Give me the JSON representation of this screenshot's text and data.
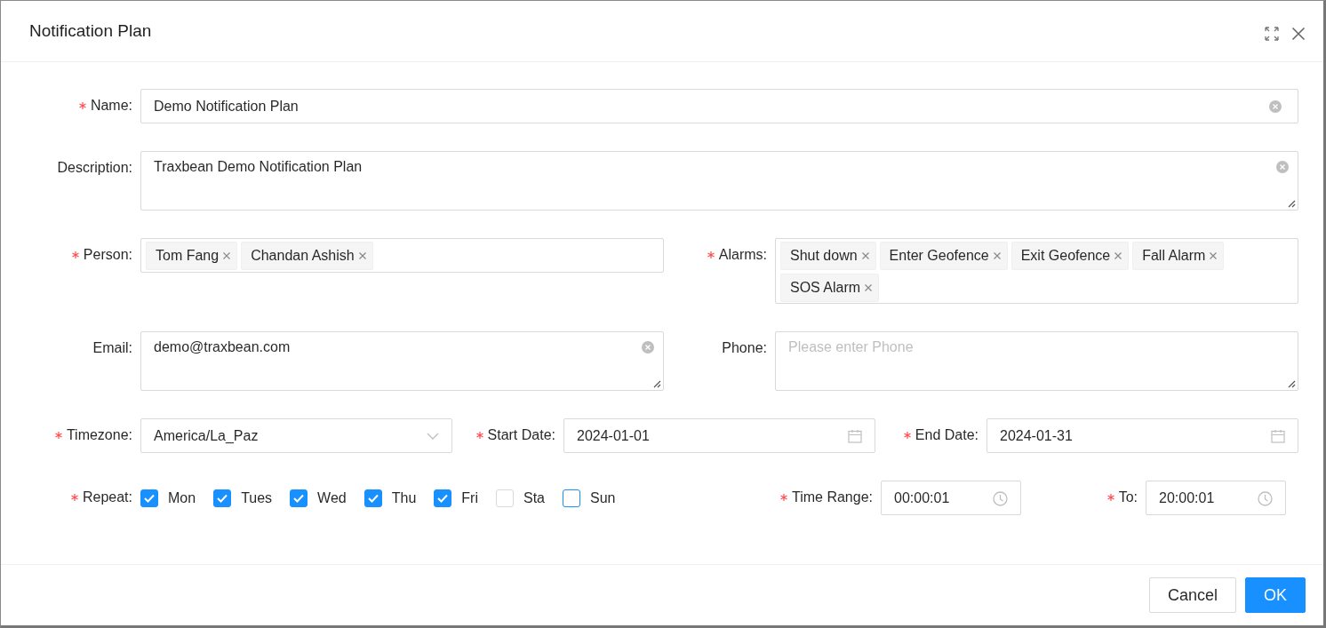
{
  "dialog": {
    "title": "Notification Plan"
  },
  "name": {
    "label": "Name:",
    "required": true,
    "value": "Demo Notification Plan",
    "clearable": true
  },
  "description": {
    "label": "Description:",
    "required": false,
    "value": "Traxbean Demo Notification Plan",
    "clearable": true
  },
  "person": {
    "label": "Person:",
    "required": true,
    "tags": [
      "Tom Fang",
      "Chandan Ashish"
    ]
  },
  "alarms": {
    "label": "Alarms:",
    "required": true,
    "tags": [
      "Shut down",
      "Enter Geofence",
      "Exit Geofence",
      "Fall Alarm",
      "SOS Alarm"
    ]
  },
  "email": {
    "label": "Email:",
    "required": false,
    "value": "demo@traxbean.com",
    "clearable": true
  },
  "phone": {
    "label": "Phone:",
    "required": false,
    "placeholder": "Please enter Phone",
    "clearable": false
  },
  "timezone": {
    "label": "Timezone:",
    "required": true,
    "value": "America/La_Paz"
  },
  "start_date": {
    "label": "Start Date:",
    "required": true,
    "value": "2024-01-01"
  },
  "end_date": {
    "label": "End Date:",
    "required": true,
    "value": "2024-01-31"
  },
  "repeat": {
    "label": "Repeat:",
    "required": true,
    "days": [
      {
        "label": "Mon",
        "checked": true,
        "focused": false
      },
      {
        "label": "Tues",
        "checked": true,
        "focused": false
      },
      {
        "label": "Wed",
        "checked": true,
        "focused": false
      },
      {
        "label": "Thu",
        "checked": true,
        "focused": false
      },
      {
        "label": "Fri",
        "checked": true,
        "focused": false
      },
      {
        "label": "Sta",
        "checked": false,
        "focused": false
      },
      {
        "label": "Sun",
        "checked": false,
        "focused": true
      }
    ]
  },
  "time_range": {
    "label": "Time Range:",
    "required": true,
    "value": "00:00:01"
  },
  "to": {
    "label": "To:",
    "required": true,
    "value": "20:00:01"
  },
  "buttons": [
    {
      "label": "Cancel",
      "kind": "default"
    },
    {
      "label": "OK",
      "kind": "primary"
    }
  ]
}
